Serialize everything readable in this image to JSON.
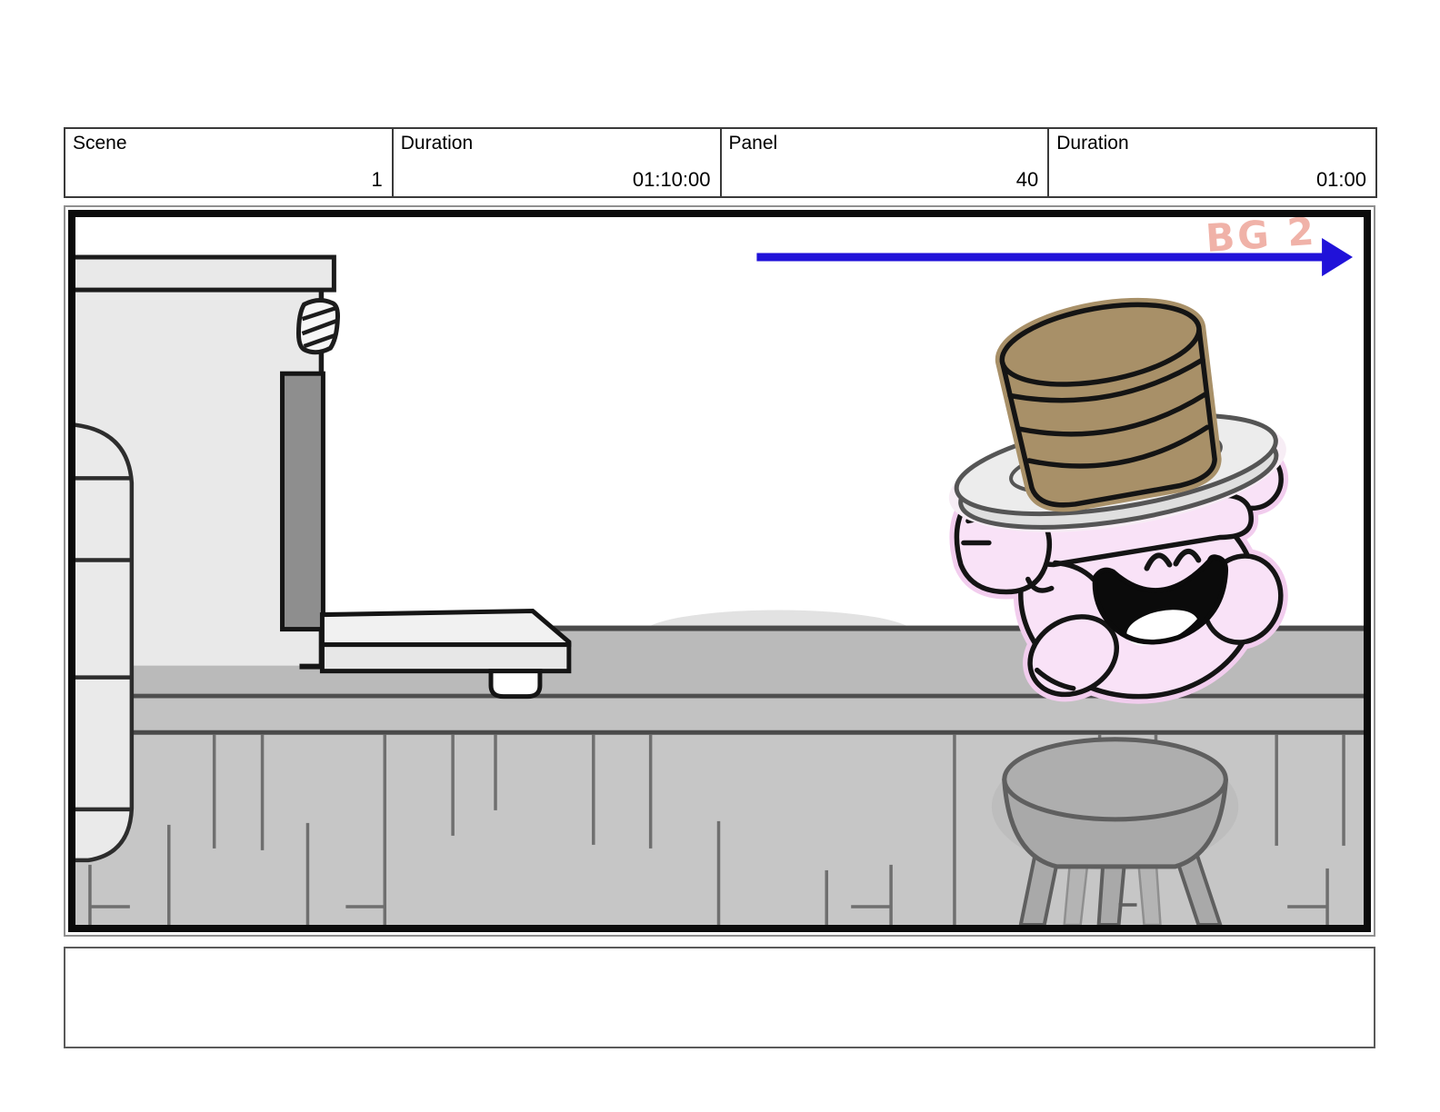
{
  "header": {
    "cells": [
      {
        "label": "Scene",
        "value": "1"
      },
      {
        "label": "Duration",
        "value": "01:10:00"
      },
      {
        "label": "Panel",
        "value": "40"
      },
      {
        "label": "Duration",
        "value": "01:00"
      }
    ]
  },
  "panel": {
    "bg_label": "BG 2",
    "bg_label_color": "#f0b2a8",
    "arrow_color": "#2012d9"
  },
  "caption": {
    "text": ""
  },
  "colors": {
    "character_pink": "#f9e2f7",
    "character_halo": "#f2cdee",
    "pancake_tan": "#a89068",
    "plate_gray": "#ececec",
    "counter_top_gray": "#bababa",
    "counter_front_gray": "#c6c6c6",
    "stool_gray": "#a9a9a9",
    "appliance_gray": "#e9e9e9",
    "outline_black": "#141414",
    "arrow_blue": "#2012d9",
    "bg_label_pink": "#f0b2a8"
  }
}
